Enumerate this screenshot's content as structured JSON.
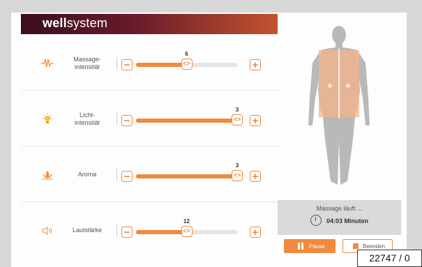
{
  "brand": {
    "bold": "well",
    "rest": "system"
  },
  "controls": [
    {
      "label_line1": "Massage-",
      "label_line2": "intensität",
      "value": "6",
      "level": 0.5,
      "icon": "massage-wave-icon"
    },
    {
      "label_line1": "Licht-",
      "label_line2": "intensität",
      "value": "3",
      "level": 1.0,
      "icon": "light-bulb-icon"
    },
    {
      "label_line1": "Aroma",
      "label_line2": "",
      "value": "3",
      "level": 1.0,
      "icon": "lotus-icon"
    },
    {
      "label_line1": "Lautstärke",
      "label_line2": "",
      "value": "12",
      "level": 0.5,
      "icon": "speaker-icon"
    }
  ],
  "buttons": {
    "minus": "−",
    "plus": "+",
    "knob": "<>"
  },
  "status": {
    "title": "Massage läuft ...",
    "time": "04:03 Minuten"
  },
  "actions": {
    "pause": "Pause",
    "stop": "Beenden"
  },
  "counter": "22747 / 0",
  "colors": {
    "accent": "#f08a3e",
    "brand_dark": "#3a0f1f",
    "zone": "#f5b48a"
  }
}
